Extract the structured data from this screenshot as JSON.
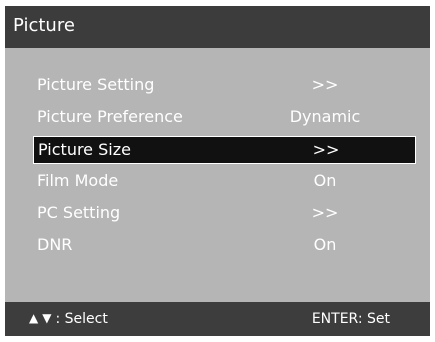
{
  "window": {
    "title": "Picture"
  },
  "menu": {
    "rows": [
      {
        "label": "Picture Setting",
        "value": ">>"
      },
      {
        "label": "Picture Preference",
        "value": "Dynamic"
      },
      {
        "label": "Picture Size",
        "value": ">>"
      },
      {
        "label": "Film Mode",
        "value": "On"
      },
      {
        "label": "PC Setting",
        "value": ">>"
      },
      {
        "label": "DNR",
        "value": "On"
      }
    ],
    "selected_index": 2
  },
  "footer": {
    "up_icon": "▲",
    "down_icon": "▼",
    "select_text": ": Select",
    "enter_text": "ENTER: Set"
  },
  "colors": {
    "title_bar": "#3c3c3c",
    "menu_background": "#b5b5b5",
    "selected_row": "#111111",
    "footer_background": "#3d3d3d",
    "text": "#ffffff"
  },
  "icons": {
    "up": "arrow-up-icon",
    "down": "arrow-down-icon"
  }
}
